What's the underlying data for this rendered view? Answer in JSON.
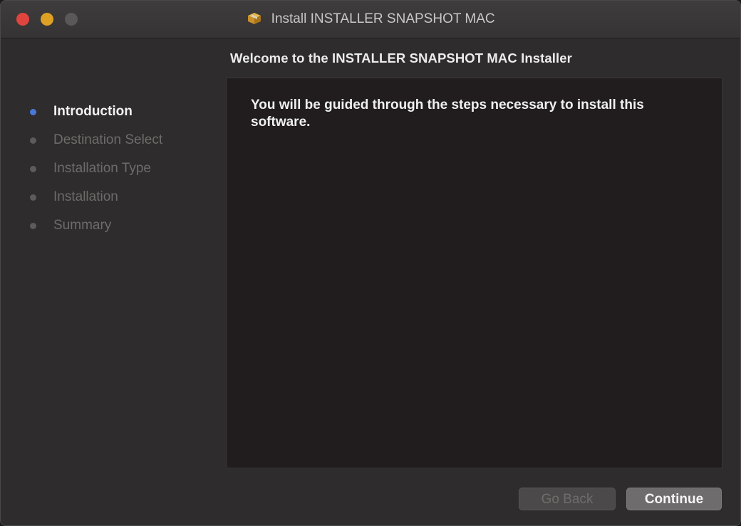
{
  "window": {
    "title": "Install INSTALLER SNAPSHOT MAC",
    "title_icon": "package-icon"
  },
  "heading": "Welcome to the INSTALLER SNAPSHOT MAC Installer",
  "sidebar": {
    "steps": [
      {
        "label": "Introduction",
        "state": "active"
      },
      {
        "label": "Destination Select",
        "state": "inactive"
      },
      {
        "label": "Installation Type",
        "state": "inactive"
      },
      {
        "label": "Installation",
        "state": "inactive"
      },
      {
        "label": "Summary",
        "state": "inactive"
      }
    ]
  },
  "content": {
    "body": "You will be guided through the steps necessary to install this software."
  },
  "buttons": {
    "back_label": "Go Back",
    "continue_label": "Continue"
  },
  "colors": {
    "active_step_dot": "#4a78d9",
    "close": "#e0443e",
    "minimize": "#dea123"
  }
}
